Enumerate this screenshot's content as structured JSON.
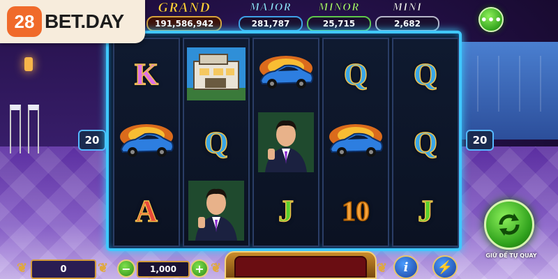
{
  "logo": {
    "badge": "28",
    "text": "BET.DAY"
  },
  "jackpots": {
    "grand": {
      "name": "GRAND",
      "value": "191,586,942"
    },
    "major": {
      "name": "MAJOR",
      "value": "281,787"
    },
    "minor": {
      "name": "MINOR",
      "value": "25,715"
    },
    "mini": {
      "name": "MINI",
      "value": "2,682"
    }
  },
  "menu": {
    "icon": "more-dots-icon",
    "label": "•••"
  },
  "lines": {
    "left": "20",
    "right": "20"
  },
  "reels": [
    [
      "K",
      "car",
      "A"
    ],
    [
      "mansion",
      "Q",
      "man"
    ],
    [
      "car",
      "man",
      "J"
    ],
    [
      "Q",
      "car",
      "10"
    ],
    [
      "Q",
      "Q",
      "J"
    ]
  ],
  "controls": {
    "credit": "0",
    "bet": "1,000",
    "minus": "−",
    "plus": "+",
    "info": "i",
    "turbo": "⚡",
    "autospin_label": "GIỮ ĐỂ TỰ QUAY"
  },
  "colors": {
    "accent": "#40c8ff",
    "spin": "#35a51f",
    "gold": "#d39a3a"
  }
}
